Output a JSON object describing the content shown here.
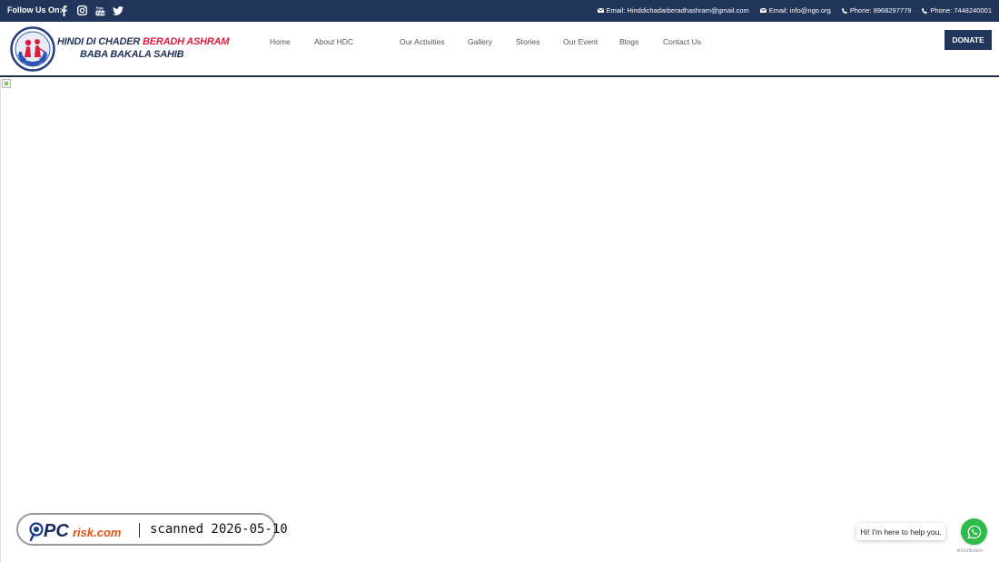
{
  "topbar": {
    "follow_label": "Follow Us On:",
    "social_icons": [
      "facebook-icon",
      "instagram-icon",
      "youtube-icon",
      "twitter-icon"
    ],
    "contacts": [
      {
        "icon": "envelope-icon",
        "text": "Email: Hinddichadarberadhashram@gmail.com"
      },
      {
        "icon": "envelope-icon",
        "text": "Email: info@ngo.org"
      },
      {
        "icon": "phone-icon",
        "text": "Phone: 8968297779"
      },
      {
        "icon": "phone-icon",
        "text": "Phone: 7448240001"
      }
    ]
  },
  "header": {
    "brand_line1_part1": "HINDI DI CHADER",
    "brand_line1_part2": " BERADH ASHRAM",
    "brand_line2": "BABA BAKALA SAHIB",
    "nav": [
      "Home",
      "About HDC",
      "Our Activities",
      "Gallery",
      "Stories",
      "Our Event",
      "Blogs",
      "Contact Us"
    ],
    "donate_label": "DONATE"
  },
  "watermark": {
    "logo_text": "PCrisk.com",
    "scan_text": "scanned 2026-05-10"
  },
  "chat": {
    "bubble_text": "Hi! I'm here to help you.",
    "powered_by": "GetButton"
  },
  "colors": {
    "navy": "#22355a",
    "brand_red": "#e01b3c",
    "whatsapp_green": "#2fba4a"
  }
}
